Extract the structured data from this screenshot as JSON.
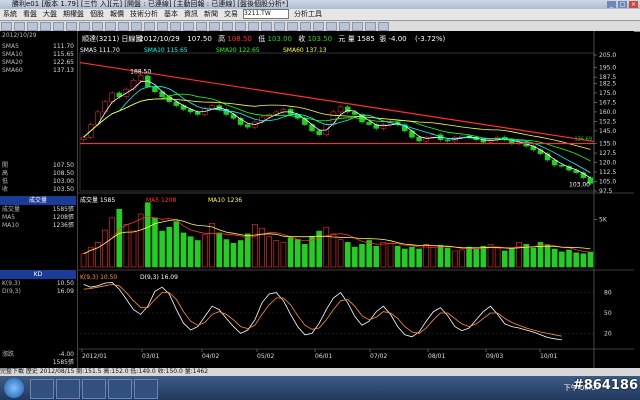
{
  "window": {
    "title": "勝利e01 [版本 1.79] [三竹 入][元] [開盤 : 已連線] [主動回報 : 已連線] [盤後個股分析*]"
  },
  "menubar": {
    "items": [
      "系統",
      "看盤",
      "大盤",
      "期權盤",
      "個股",
      "報價",
      "技術分析",
      "基本",
      "資訊",
      "新聞",
      "交易"
    ],
    "symbol_value": "3211.TW",
    "analysis_label": "分析工具"
  },
  "left_panel": {
    "date": "2012/10/29",
    "ma_list": [
      {
        "label": "SMA5",
        "value": "111.70"
      },
      {
        "label": "SMA10",
        "value": "115.65"
      },
      {
        "label": "SMA20",
        "value": "122.65"
      },
      {
        "label": "SMA60",
        "value": "137.13"
      }
    ],
    "ohlc": [
      {
        "label": "開",
        "value": "107.50"
      },
      {
        "label": "高",
        "value": "108.50"
      },
      {
        "label": "低",
        "value": "103.00"
      },
      {
        "label": "收",
        "value": "103.50"
      }
    ],
    "volume_header": "成交量",
    "volume_list": [
      {
        "label": "成交量",
        "value": "1585張"
      },
      {
        "label": "MA5",
        "value": "1208張"
      },
      {
        "label": "MA10",
        "value": "1236張"
      }
    ],
    "kd_header": "KD",
    "kd_list": [
      {
        "label": "K(9,3)",
        "value": "10.50"
      },
      {
        "label": "D(9,3)",
        "value": "16.09"
      }
    ],
    "bottom_list": [
      {
        "label": "漲跌",
        "value": "-4.00"
      },
      {
        "label": "",
        "value": "1585張"
      }
    ]
  },
  "header": {
    "name": "順達(3211)",
    "period": "日線圖",
    "date": "2012/10/29",
    "open_val": "107.50",
    "high_label": "高",
    "high_val": "108.50",
    "low_label": "低",
    "low_val": "103.00",
    "close_label": "收",
    "close_val": "103.50",
    "unit": "元",
    "vol_label": "量",
    "vol_val": "1585",
    "vol_unit": "張",
    "change": "-4.00",
    "change_pct": "(-3.72%)"
  },
  "ma_legend": {
    "sma5": "SMA5 111.70",
    "sma10": "SMA10 115.65",
    "sma20": "SMA20 122.65",
    "sma60": "SMA60 137.13"
  },
  "vol_legend": {
    "vol": "成交量 1585",
    "ma5": "MA5 1208",
    "ma10": "MA10 1236",
    "unit": "張"
  },
  "kd_legend": {
    "k": "K(9,3) 10.50",
    "d": "D(9,3) 16.09"
  },
  "annotations": {
    "peak": "188.50",
    "last": "103.00",
    "trendline_value": "136.69"
  },
  "status_bar": {
    "text": "完整下載  歷史 2012/08/15 開:151.5 高:152.0 低:149.0 收:150.0 量:1462"
  },
  "taskbar": {
    "clock": "下午 08:07",
    "watermark": "#864186"
  },
  "colors": {
    "up": "#ff3030",
    "down": "#20d020",
    "sma5": "#ffffff",
    "sma10": "#00ffff",
    "sma20": "#20ff20",
    "sma60": "#ffff40",
    "k": "#ffffff",
    "d": "#ff9030",
    "trend": "#ff3030"
  },
  "chart_data": [
    {
      "type": "candlestick",
      "title": "順達(3211) 日線圖",
      "x_ticks": [
        "2012/01",
        "03/01",
        "04/02",
        "05/02",
        "06/01",
        "07/02",
        "08/01",
        "09/03",
        "10/01"
      ],
      "y_ticks": [
        "205.0",
        "195.0",
        "187.5",
        "182.5",
        "175.0",
        "167.5",
        "160.0",
        "152.5",
        "145.0",
        "135.0",
        "127.5",
        "120.0",
        "112.5",
        "105.0",
        "97.5"
      ],
      "ylim": [
        97.5,
        205
      ],
      "close_path": [
        140,
        150,
        160,
        168,
        175,
        172,
        178,
        185,
        188.5,
        180,
        176,
        172,
        168,
        165,
        162,
        160,
        158,
        163,
        165,
        162,
        158,
        155,
        150,
        148,
        152,
        156,
        158,
        160,
        162,
        158,
        155,
        150,
        145,
        142,
        150,
        160,
        164,
        160,
        158,
        152,
        150,
        147,
        150,
        152,
        150,
        145,
        140,
        137,
        140,
        142,
        138,
        137,
        140,
        141,
        140,
        138,
        136,
        138,
        140,
        138,
        135,
        136,
        133,
        130,
        127,
        122,
        118,
        117,
        114,
        112,
        108,
        103.5
      ]
    },
    {
      "type": "bar",
      "title": "成交量",
      "y_ticks": [
        "5K"
      ],
      "values": [
        1400,
        2100,
        2600,
        3900,
        5200,
        6100,
        4500,
        3800,
        5600,
        6800,
        5200,
        3800,
        4200,
        4800,
        3600,
        3200,
        2800,
        3400,
        4600,
        3600,
        2900,
        2500,
        2800,
        3500,
        4500,
        4100,
        3200,
        2800,
        2600,
        3100,
        2900,
        2400,
        3200,
        3800,
        4200,
        3500,
        2900,
        2600,
        2100,
        2400,
        2800,
        2200,
        2600,
        2500,
        2200,
        1900,
        2100,
        1900,
        2400,
        2100,
        2300,
        2000,
        1700,
        1800,
        2100,
        1900,
        2200,
        2400,
        2000,
        1700,
        1900,
        2600,
        2400,
        2000,
        2600,
        2300,
        1900,
        1600,
        1800,
        1500,
        1400,
        1585
      ]
    },
    {
      "type": "line",
      "title": "KD",
      "y_ticks": [
        "80",
        "50",
        "20"
      ],
      "ylim": [
        0,
        100
      ],
      "series": [
        {
          "name": "K(9,3)",
          "values": [
            92,
            88,
            90,
            94,
            95,
            85,
            70,
            55,
            48,
            60,
            82,
            88,
            78,
            55,
            35,
            25,
            30,
            45,
            60,
            55,
            42,
            30,
            20,
            25,
            40,
            65,
            78,
            80,
            68,
            48,
            30,
            18,
            20,
            35,
            55,
            72,
            80,
            65,
            45,
            32,
            38,
            52,
            60,
            48,
            30,
            18,
            15,
            22,
            38,
            52,
            58,
            46,
            30,
            24,
            28,
            40,
            52,
            60,
            48,
            34,
            30,
            28,
            25,
            22,
            18,
            14,
            12,
            10.5
          ]
        },
        {
          "name": "D(9,3)",
          "values": [
            85,
            86,
            88,
            90,
            92,
            90,
            80,
            68,
            58,
            58,
            70,
            80,
            80,
            70,
            52,
            38,
            32,
            36,
            48,
            52,
            48,
            40,
            30,
            27,
            32,
            48,
            62,
            72,
            72,
            62,
            46,
            32,
            26,
            28,
            40,
            55,
            68,
            70,
            60,
            46,
            40,
            44,
            52,
            50,
            42,
            30,
            22,
            20,
            28,
            40,
            50,
            50,
            42,
            34,
            30,
            34,
            42,
            50,
            50,
            42,
            36,
            32,
            28,
            25,
            22,
            20,
            18,
            16.09
          ]
        }
      ]
    }
  ]
}
